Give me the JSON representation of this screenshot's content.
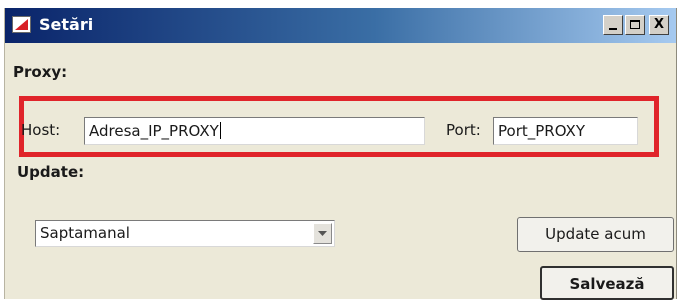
{
  "window": {
    "title": "Setări",
    "controls": {
      "minimize": "_",
      "maximize": "□",
      "close": "X"
    },
    "title_gradient": [
      "#0a246a",
      "#3a6ea5",
      "#a6caf0"
    ]
  },
  "proxy": {
    "section_label": "Proxy:",
    "host_label": "Host:",
    "host_value": "Adresa_IP_PROXY",
    "port_label": "Port:",
    "port_value": "Port_PROXY",
    "highlight_color": "#e0242a"
  },
  "update": {
    "section_label": "Update:",
    "frequency_selected": "Saptamanal",
    "update_now_label": "Update acum"
  },
  "footer": {
    "save_label": "Salvează"
  },
  "icons": {
    "app": "app-logo-icon",
    "dropdown": "chevron-down-icon"
  }
}
